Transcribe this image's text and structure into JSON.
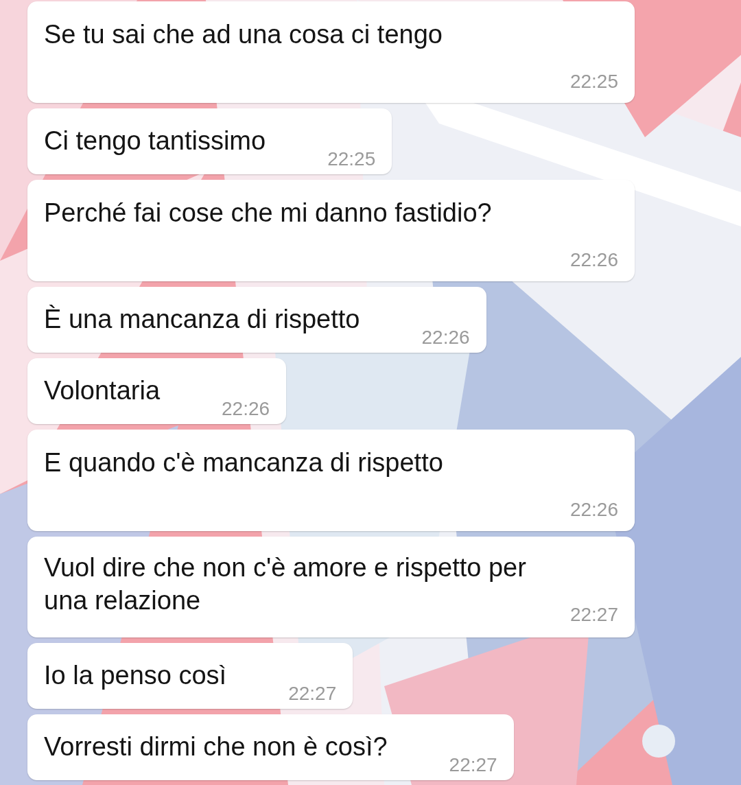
{
  "messages": [
    {
      "kind": "stacked",
      "text": "Se tu sai che ad una cosa ci tengo",
      "time": "22:25"
    },
    {
      "kind": "compact",
      "text": "Ci tengo tantissimo",
      "time": "22:25"
    },
    {
      "kind": "stacked",
      "text": "Perché fai cose che mi danno fastidio?",
      "time": "22:26"
    },
    {
      "kind": "compact",
      "text": "È una mancanza di rispetto",
      "time": "22:26"
    },
    {
      "kind": "compact",
      "text": "Volontaria",
      "time": "22:26"
    },
    {
      "kind": "stacked",
      "text": "E quando c'è mancanza di rispetto",
      "time": "22:26"
    },
    {
      "kind": "wrapped",
      "text": "Vuol dire che non c'è amore e rispetto per una relazione",
      "time": "22:27"
    },
    {
      "kind": "compact",
      "text": "Io la penso così",
      "time": "22:27"
    },
    {
      "kind": "compact",
      "text": "Vorresti dirmi che non è così?",
      "time": "22:27"
    }
  ]
}
